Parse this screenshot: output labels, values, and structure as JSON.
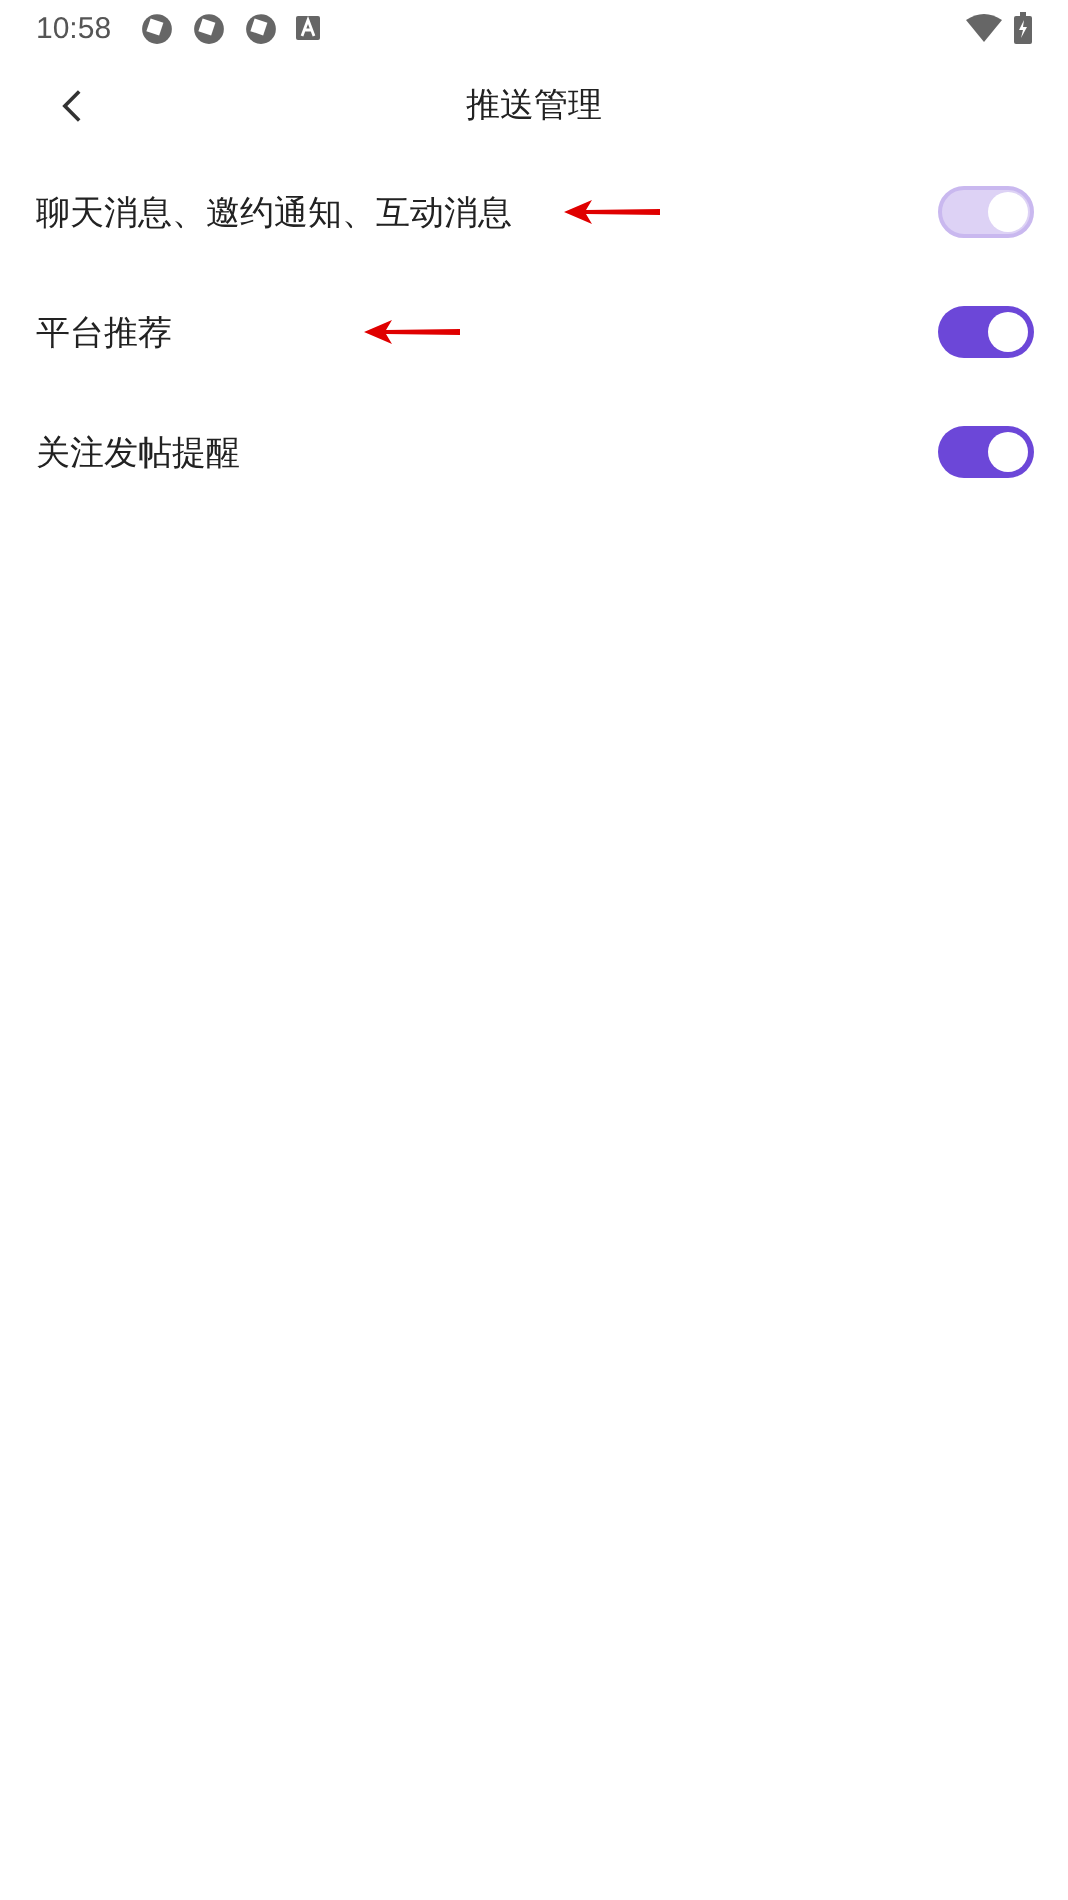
{
  "status_bar": {
    "time": "10:58"
  },
  "header": {
    "title": "推送管理"
  },
  "settings": [
    {
      "label": "聊天消息、邀约通知、互动消息",
      "on": true,
      "disabled": true,
      "annotated": true
    },
    {
      "label": "平台推荐",
      "on": true,
      "disabled": false,
      "annotated": true
    },
    {
      "label": "关注发帖提醒",
      "on": true,
      "disabled": false,
      "annotated": false
    }
  ]
}
